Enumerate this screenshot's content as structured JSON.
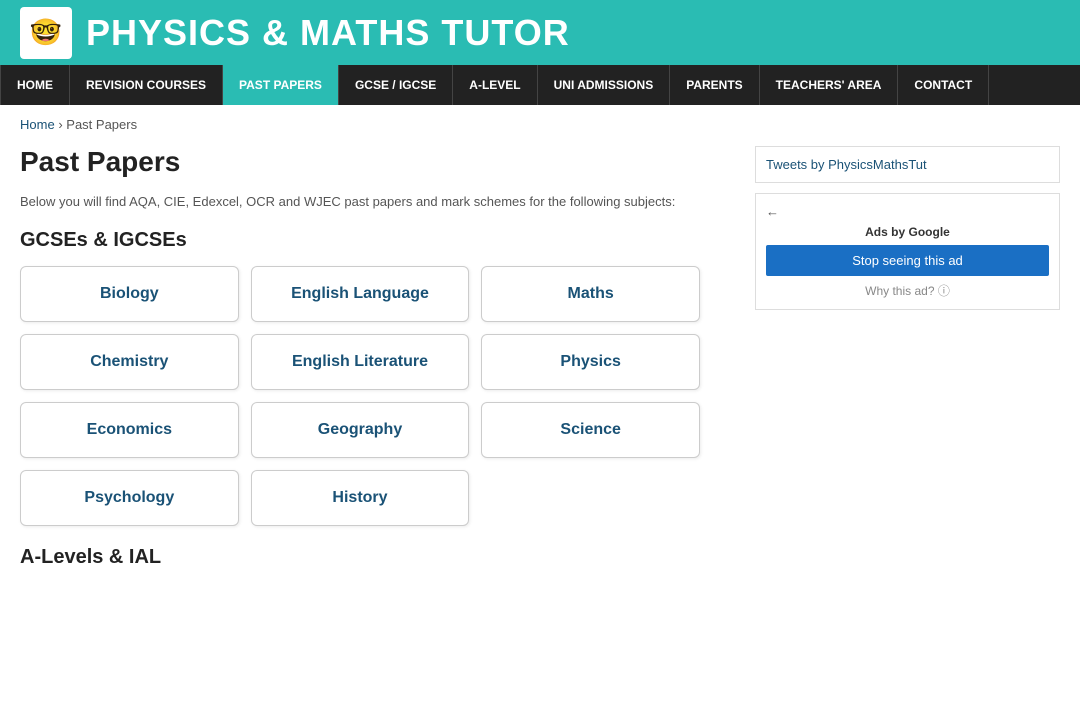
{
  "header": {
    "logo_emoji": "🤓",
    "title": "PHYSICS & MATHS TUTOR"
  },
  "nav": {
    "items": [
      {
        "label": "HOME",
        "active": false
      },
      {
        "label": "REVISION COURSES",
        "active": false
      },
      {
        "label": "PAST PAPERS",
        "active": true
      },
      {
        "label": "GCSE / IGCSE",
        "active": false
      },
      {
        "label": "A-LEVEL",
        "active": false
      },
      {
        "label": "UNI ADMISSIONS",
        "active": false
      },
      {
        "label": "PARENTS",
        "active": false
      },
      {
        "label": "TEACHERS' AREA",
        "active": false
      },
      {
        "label": "CONTACT",
        "active": false
      }
    ]
  },
  "breadcrumb": {
    "home": "Home",
    "separator": "›",
    "current": "Past Papers"
  },
  "content": {
    "page_title": "Past Papers",
    "page_desc": "Below you will find AQA, CIE, Edexcel, OCR and WJEC past papers and mark schemes for the following subjects:",
    "gcse_section": {
      "heading": "GCSEs & IGCSEs",
      "subjects": [
        {
          "label": "Biology",
          "col": 0,
          "row": 0
        },
        {
          "label": "English Language",
          "col": 1,
          "row": 0
        },
        {
          "label": "Maths",
          "col": 2,
          "row": 0
        },
        {
          "label": "Chemistry",
          "col": 0,
          "row": 1
        },
        {
          "label": "English Literature",
          "col": 1,
          "row": 1
        },
        {
          "label": "Physics",
          "col": 2,
          "row": 1
        },
        {
          "label": "Economics",
          "col": 0,
          "row": 2
        },
        {
          "label": "Geography",
          "col": 1,
          "row": 2
        },
        {
          "label": "Science",
          "col": 2,
          "row": 2
        },
        {
          "label": "Psychology",
          "col": 0,
          "row": 3
        },
        {
          "label": "History",
          "col": 1,
          "row": 3
        }
      ]
    },
    "alevels_section": {
      "heading": "A-Levels & IAL"
    }
  },
  "sidebar": {
    "tweets_label": "Tweets by PhysicsMathsTut",
    "ad_label": "Ads by",
    "ad_brand": "Google",
    "ad_stop_btn": "Stop seeing this ad",
    "ad_why": "Why this ad? ⓘ",
    "back_arrow": "←"
  }
}
